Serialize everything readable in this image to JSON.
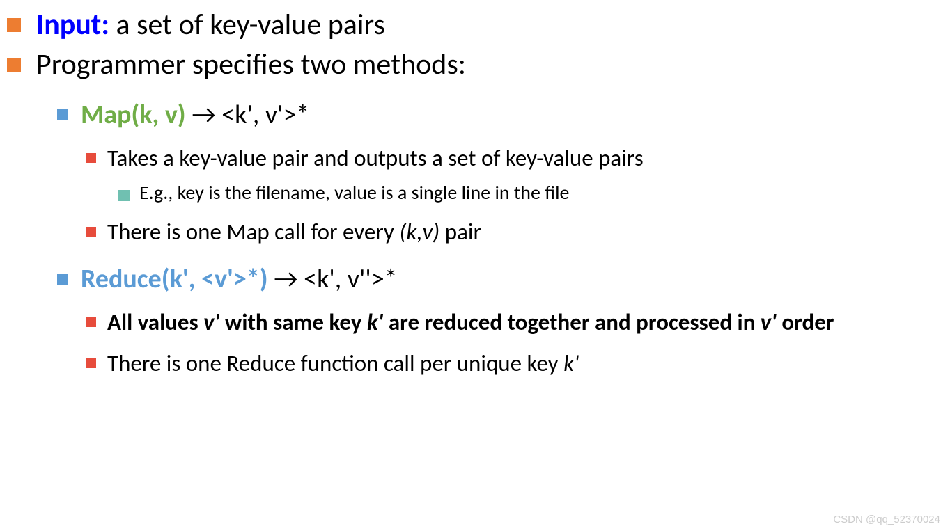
{
  "line1": {
    "input_label": "Input:",
    "rest": " a set of key-value pairs"
  },
  "line2": "Programmer specifies two methods:",
  "map": {
    "func": "Map(k, v)",
    "arrow": " → <k', v'>*",
    "desc1": "Takes a key-value pair and outputs a set of key-value pairs",
    "example": "E.g., key is the filename, value is a single line in the file",
    "desc2_pre": "There is one Map call for every ",
    "desc2_kv": "(k,v)",
    "desc2_post": " pair"
  },
  "reduce": {
    "func": "Reduce(k', <v'>*)",
    "arrow": " → <k', v''>*",
    "desc1_p1": "All values ",
    "desc1_v1": "v'",
    "desc1_p2": " with same key ",
    "desc1_k": "k'",
    "desc1_p3": " are reduced together and processed in ",
    "desc1_v2": "v'",
    "desc1_p4": " order",
    "desc2_pre": "There is one Reduce function call per unique key ",
    "desc2_k": "k'"
  },
  "watermark": "CSDN @qq_52370024"
}
